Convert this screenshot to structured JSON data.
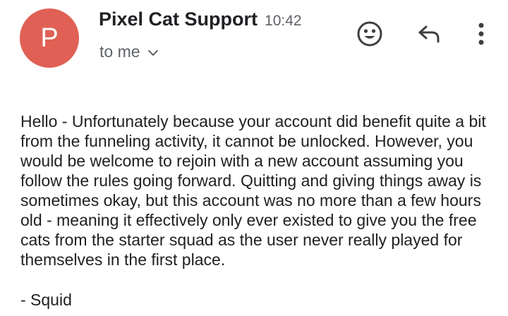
{
  "sender": {
    "initial": "P",
    "avatar_color": "#e06055",
    "name": "Pixel Cat Support",
    "time": "10:42",
    "recipient": "to me"
  },
  "icons": {
    "recipient_toggle": "chevron-down-icon",
    "emoji": "emoji-reaction-icon",
    "reply": "reply-icon",
    "more": "more-vert-icon"
  },
  "message": {
    "body": "Hello - Unfortunately because your account did benefit quite a bit from the funneling activity, it cannot be unlocked. However, you would be welcome to rejoin with a new account assuming you follow the rules going forward. Quitting and giving things away is sometimes okay, but this account was no more than a few hours old - meaning it effectively only ever existed to give you the free cats from the starter squad as the user never really played for themselves in the first place.",
    "signature": "- Squid"
  },
  "colors": {
    "text_primary": "#202124",
    "text_secondary": "#5f6368",
    "icon": "#3c4043"
  }
}
